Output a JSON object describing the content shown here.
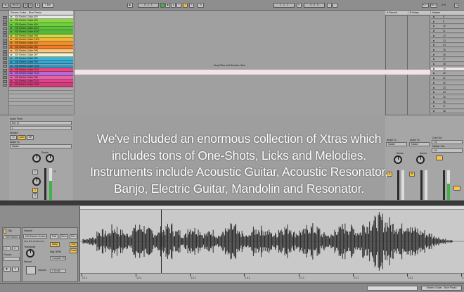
{
  "transport": {
    "tap": "Tap",
    "tempo": "96.00",
    "sig_num": "4",
    "sig_den": "4",
    "metro": "1 Bar",
    "position": "5 . 1 . 1",
    "loop_start": "1 . 1 . 1",
    "loop_len": "4 . 0 . 0",
    "key": "KEY",
    "midi": "MIDI",
    "cpu": "4 %",
    "dsp": "D"
  },
  "tracks": {
    "track1_title": "Electric Guitar - Blue Pianio",
    "a_reverb": "A Reverb",
    "b_delay": "B Delay",
    "master": "Master"
  },
  "clips": [
    {
      "name": "000 Electric Guitar A90",
      "color": "#e9e9e9"
    },
    {
      "name": "000 Electric Guitar A95",
      "color": "#8ad73e"
    },
    {
      "name": "000 Electric Guitar A98",
      "color": "#6dd042"
    },
    {
      "name": "000 Electric Guitar A119",
      "color": "#5fc23f"
    },
    {
      "name": "000 Electric Guitar A120",
      "color": "#56b83c"
    },
    {
      "name": "000 Electric Guitar C95",
      "color": "#d7d745"
    },
    {
      "name": "000 Electric Guitar C120",
      "color": "#f0b43a"
    },
    {
      "name": "000 Electric Guitar D22",
      "color": "#ef8c2b"
    },
    {
      "name": "000 Electric Guitar D90",
      "color": "#f17d2a"
    },
    {
      "name": "000 Electric Guitar D95",
      "color": "#f5c883"
    },
    {
      "name": "000 Electric Guitar D97",
      "color": "#f8f2c8"
    },
    {
      "name": "000 Electric Guitar F60",
      "color": "#3fb4d9"
    },
    {
      "name": "000 Electric Guitar F95",
      "color": "#35a7d2"
    },
    {
      "name": "000 Electric Guitar F108",
      "color": "#2f98c7"
    },
    {
      "name": "000 Electric Guitar F110",
      "color": "#f2447a"
    },
    {
      "name": "000 Electric Guitar F123",
      "color": "#b86bd8"
    },
    {
      "name": "000 Electric Guitar F88",
      "color": "#e763a4"
    },
    {
      "name": "000 Electric Guitar F120",
      "color": "#e0448a"
    },
    {
      "name": "000 Electric Guitar F136",
      "color": "#d23c78"
    }
  ],
  "scenes": [
    "8",
    "9",
    "10",
    "11",
    "12",
    "13",
    "14",
    "15",
    "16",
    "17",
    "18",
    "19",
    "20",
    "21",
    "22",
    "23",
    "24",
    "25",
    "26",
    "27",
    "28"
  ],
  "drop_text": "Drop Files and Devices Here",
  "io": {
    "audio_from": "Audio From",
    "audio_from_val": "Ext. In",
    "input_ch": "1",
    "monitor": "Monitor",
    "monitor_opts": [
      "In",
      "Auto",
      "Off"
    ],
    "audio_to": "Audio To",
    "audio_to_val": "Master",
    "sends": "Sends",
    "cue_out": "Cue Out",
    "cue_val": "1/2",
    "master_out": "Master Out",
    "master_val": "1/2",
    "a_audio_to_val": "Master",
    "b_audio_to_val": "Master",
    "solo": "S",
    "arm": "1",
    "vol_val": "0",
    "pan_val": "C"
  },
  "caption": [
    "We've included an enormous collection of Xtras which",
    "includes tons of One-Shots, Licks and Melodies.",
    "Instruments include Acoustic Guitar, Acoustic Resonator,",
    "Banjo, Electric Guitar, Mandolin and Resonator."
  ],
  "clip_view": {
    "clip_label": "Clip",
    "clip_name": "000 Electric",
    "sample_label": "Sample",
    "sample_name": "000 Electric Guitar A",
    "sample_info": "44.1 kHz 24 Bit 2 Ch",
    "edit": "Edit",
    "save": "Save",
    "rev": "Rev.",
    "warp": "Warp",
    "hi_q": "HiQ",
    "fade": "Fade",
    "seg_bpm": "Seg. BPM",
    "complex": "Complex Pro",
    "transpose": "Transpose",
    "detune": "Detune",
    "volume": "Volume",
    "vol_val": "0.00 dB",
    "signature_num": "4",
    "signature_den": "4",
    "groove": "Groove",
    "start_label": "Start",
    "end_label": "End",
    "loop_label": "Loop",
    "waveform_peaks": [
      0.1,
      0.15,
      0.4,
      0.35,
      0.55,
      0.4,
      0.3,
      0.55,
      0.6,
      0.45,
      0.35,
      0.5,
      0.62,
      0.4,
      0.28,
      0.58,
      0.5,
      0.3,
      0.4,
      0.25,
      0.45,
      0.6,
      0.35,
      0.22,
      0.48,
      0.52,
      0.4,
      0.3,
      0.55,
      0.58,
      0.35,
      0.42,
      0.6,
      0.5,
      0.3,
      0.25,
      0.5,
      0.62,
      0.55,
      0.4,
      0.7,
      0.85,
      0.95,
      0.8,
      0.7,
      0.6,
      0.75,
      0.5,
      0.4,
      0.3,
      0.2,
      0.1,
      0.04
    ]
  },
  "ruler": [
    "1.1.1",
    "1.2.1",
    "1.3.1",
    "1.4.1",
    "2.1.1",
    "2.2.1",
    "2.3.1",
    "2.4.1"
  ],
  "status": {
    "left": "",
    "track_label": "Electric Guitar - Blue Pianio"
  },
  "colors": {
    "accent_yellow": "#f6c54a",
    "meter_green": "#3fb24a",
    "waveform": "#1b1b1b",
    "loop_brace": "#dcdcdc"
  }
}
